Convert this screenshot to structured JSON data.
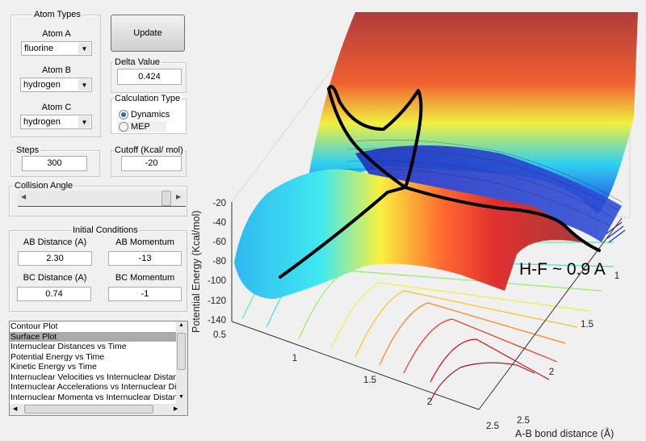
{
  "atom_types": {
    "title": "Atom Types",
    "atom_a": {
      "label": "Atom A",
      "value": "fluorine"
    },
    "atom_b": {
      "label": "Atom B",
      "value": "hydrogen"
    },
    "atom_c": {
      "label": "Atom C",
      "value": "hydrogen"
    }
  },
  "update_button": "Update",
  "delta": {
    "title": "Delta Value",
    "value": "0.424"
  },
  "calc_type": {
    "title": "Calculation Type",
    "options": [
      "Dynamics",
      "MEP"
    ],
    "selected": "Dynamics"
  },
  "steps": {
    "title": "Steps",
    "value": "300"
  },
  "cutoff": {
    "title": "Cutoff (Kcal/ mol)",
    "value": "-20"
  },
  "collision_angle": {
    "title": "Collision Angle",
    "slider_fraction": 0.97
  },
  "initial_conditions": {
    "title": "Initial Conditions",
    "ab_distance": {
      "label": "AB Distance (A)",
      "value": "2.30"
    },
    "ab_momentum": {
      "label": "AB Momentum",
      "value": "-13"
    },
    "bc_distance": {
      "label": "BC Distance (A)",
      "value": "0.74"
    },
    "bc_momentum": {
      "label": "BC Momentum",
      "value": "-1"
    }
  },
  "plot_list": {
    "items": [
      "Contour Plot",
      "Surface Plot",
      "Internuclear Distances vs Time",
      "Potential Energy vs Time",
      "Kinetic Energy vs Time",
      "Internuclear Velocities vs Internuclear Distance",
      "Internuclear Accelerations vs Internuclear Dista",
      "Internuclear Momenta vs Internuclear Distance"
    ],
    "selected": "Surface Plot"
  },
  "plot": {
    "zlabel": "Potential Energy (Kcal/mol)",
    "xlabel": "A-B bond distance (Å)",
    "z_ticks": [
      "-20",
      "-40",
      "-60",
      "-80",
      "-100",
      "-120",
      "-140"
    ],
    "ab_ticks": [
      "0.5",
      "1",
      "1.5",
      "2",
      "2.5"
    ],
    "bc_ticks": [
      "1",
      "1.5",
      "2",
      "2.5"
    ],
    "annotation": "H-F ~ 0.9 A",
    "colormap": "jet"
  }
}
